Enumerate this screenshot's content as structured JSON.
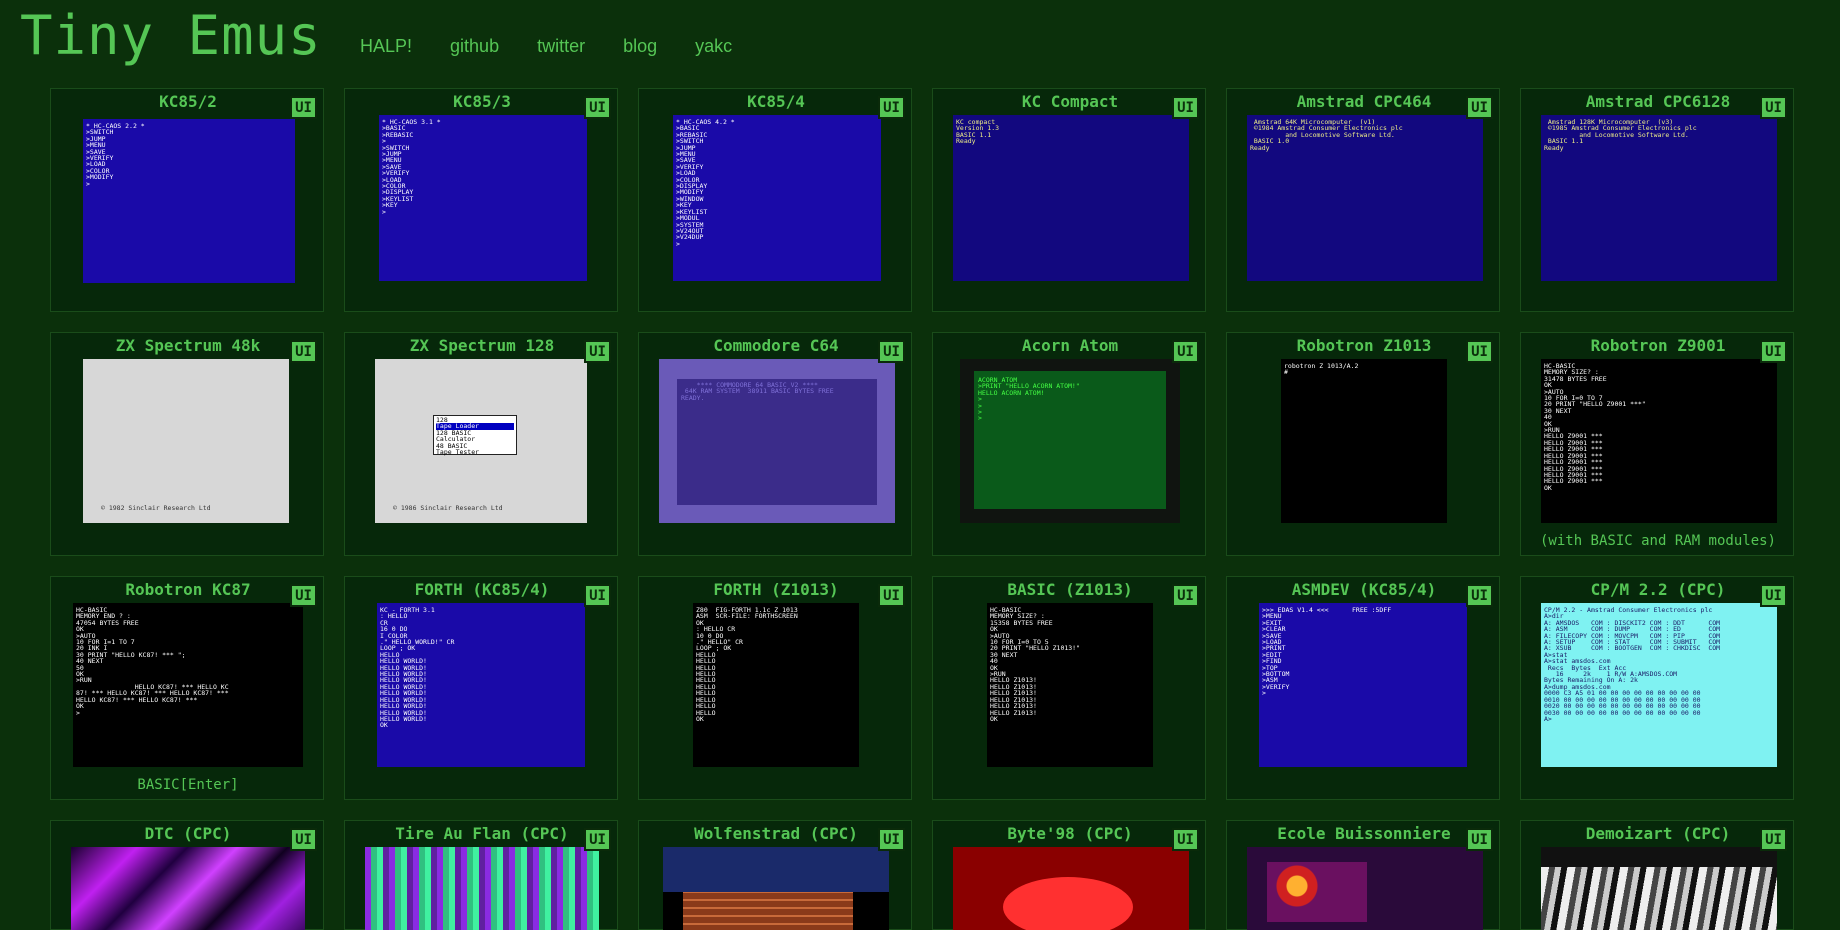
{
  "header": {
    "title": "Tiny Emus",
    "nav": [
      "HALP!",
      "github",
      "twitter",
      "blog",
      "yakc"
    ]
  },
  "ui_label": "UI",
  "cards": [
    {
      "title": "KC85/2",
      "caption": "",
      "screen": [
        "* HC-CAOS 2.2 *",
        ">SWITCH",
        ">JUMP",
        ">MENU",
        ">SAVE",
        ">VERIFY",
        ">LOAD",
        ">COLOR",
        ">MODIFY",
        ">"
      ]
    },
    {
      "title": "KC85/3",
      "caption": "",
      "screen": [
        "* HC-CAOS 3.1 *",
        ">BASIC",
        ">REBASIC",
        ">",
        ">SWITCH",
        ">JUMP",
        ">MENU",
        ">SAVE",
        ">VERIFY",
        ">LOAD",
        ">COLOR",
        ">DISPLAY",
        ">KEYLIST",
        ">KEY",
        ">"
      ]
    },
    {
      "title": "KC85/4",
      "caption": "",
      "screen": [
        "* HC-CAOS 4.2 *",
        ">BASIC",
        ">REBASIC",
        ">SWITCH",
        ">JUMP",
        ">MENU",
        ">SAVE",
        ">VERIFY",
        ">LOAD",
        ">COLOR",
        ">DISPLAY",
        ">MODIFY",
        ">WINDOW",
        ">KEY",
        ">KEYLIST",
        ">MODUL",
        ">SYSTEM",
        ">V24OUT",
        ">V24DUP",
        ">"
      ]
    },
    {
      "title": "KC Compact",
      "caption": "",
      "screen": [
        "KC compact",
        "Version 1.3",
        "",
        "BASIC 1.1",
        "",
        "Ready"
      ]
    },
    {
      "title": "Amstrad CPC464",
      "caption": "",
      "screen": [
        " Amstrad 64K Microcomputer  (v1)",
        "",
        " ©1984 Amstrad Consumer Electronics plc",
        "         and Locomotive Software Ltd.",
        "",
        " BASIC 1.0",
        "",
        "Ready"
      ]
    },
    {
      "title": "Amstrad CPC6128",
      "caption": "",
      "screen": [
        " Amstrad 128K Microcomputer  (v3)",
        "",
        " ©1985 Amstrad Consumer Electronics plc",
        "         and Locomotive Software Ltd.",
        "",
        " BASIC 1.1",
        "",
        "Ready"
      ]
    },
    {
      "title": "ZX Spectrum 48k",
      "caption": "",
      "screen": [
        "© 1982 Sinclair Research Ltd"
      ]
    },
    {
      "title": "ZX Spectrum 128",
      "caption": "",
      "screen": [
        "© 1986 Sinclair Research Ltd"
      ],
      "menu": [
        "128",
        "Tape Loader",
        "128 BASIC",
        "Calculator",
        "48 BASIC",
        "Tape Tester"
      ]
    },
    {
      "title": "Commodore C64",
      "caption": "",
      "screen": [
        "    **** COMMODORE 64 BASIC V2 ****",
        " 64K RAM SYSTEM  38911 BASIC BYTES FREE",
        "",
        "READY."
      ]
    },
    {
      "title": "Acorn Atom",
      "caption": "",
      "screen": [
        "ACORN ATOM",
        "",
        ">PRINT \"HELLO ACORN ATOM!\"",
        "HELLO ACORN ATOM!",
        ">",
        ">",
        ">",
        ">"
      ]
    },
    {
      "title": "Robotron Z1013",
      "caption": "",
      "screen": [
        "robotron Z 1013/A.2",
        "",
        "#"
      ]
    },
    {
      "title": "Robotron Z9001",
      "caption": "(with BASIC and RAM modules)",
      "screen": [
        "HC-BASIC",
        "MEMORY SIZE? :",
        "31478 BYTES FREE",
        "",
        "OK",
        ">AUTO",
        "10 FOR I=0 TO 7",
        "20 PRINT \"HELLO Z9001 ***\"",
        "30 NEXT",
        "40",
        "OK",
        ">RUN",
        "HELLO Z9001 ***",
        "HELLO Z9001 ***",
        "HELLO Z9001 ***",
        "HELLO Z9001 ***",
        "HELLO Z9001 ***",
        "HELLO Z9001 ***",
        "HELLO Z9001 ***",
        "HELLO Z9001 ***",
        "OK"
      ]
    },
    {
      "title": "Robotron KC87",
      "caption": "BASIC[Enter]",
      "screen": [
        "HC-BASIC",
        "",
        "MEMORY END ? :",
        "47054 BYTES FREE",
        "",
        "OK",
        ">AUTO",
        "10 FOR I=1 TO 7",
        "20 INK I",
        "30 PRINT \"HELLO KC87! *** \";",
        "40 NEXT",
        "50",
        "OK",
        ">RUN",
        "               HELLO KC87! *** HELLO KC",
        "87! *** HELLO KC87! *** HELLO KC87! ***",
        "HELLO KC87! *** HELLO KC87! ***",
        "OK",
        ">"
      ]
    },
    {
      "title": "FORTH (KC85/4)",
      "caption": "",
      "screen": [
        "KC - FORTH 3.1",
        ": HELLO",
        "CR",
        "16 0 DO",
        "I COLOR",
        ".\" HELLO WORLD!\" CR",
        "LOOP ; OK",
        "HELLO",
        "HELLO WORLD!",
        "HELLO WORLD!",
        "HELLO WORLD!",
        "HELLO WORLD!",
        "HELLO WORLD!",
        "HELLO WORLD!",
        "HELLO WORLD!",
        "HELLO WORLD!",
        "HELLO WORLD!",
        "HELLO WORLD!",
        "OK"
      ]
    },
    {
      "title": "FORTH (Z1013)",
      "caption": "",
      "screen": [
        "Z80  FIG-FORTH 1.1c Z 1013",
        "ASM  SCR-FILE: FORTHSCREEN",
        "",
        "OK",
        ": HELLO CR",
        "10 0 DO",
        ".\" HELLO\" CR",
        "LOOP ; OK",
        "HELLO",
        "HELLO",
        "HELLO",
        "HELLO",
        "HELLO",
        "HELLO",
        "HELLO",
        "HELLO",
        "HELLO",
        "HELLO",
        "OK"
      ]
    },
    {
      "title": "BASIC (Z1013)",
      "caption": "",
      "screen": [
        "HC-BASIC",
        "",
        "MEMORY SIZE? :",
        "15358 BYTES FREE",
        "",
        "OK",
        ">AUTO",
        "10 FOR I=0 TO 5",
        "20 PRINT \"HELLO Z1013!\"",
        "30 NEXT",
        "40",
        "OK",
        ">RUN",
        "HELLO Z1013!",
        "HELLO Z1013!",
        "HELLO Z1013!",
        "HELLO Z1013!",
        "HELLO Z1013!",
        "HELLO Z1013!",
        "OK"
      ]
    },
    {
      "title": "ASMDEV (KC85/4)",
      "caption": "",
      "screen": [
        ">>> EDAS V1.4 <<<      FREE :5DFF",
        "",
        ">MENU",
        ">EXIT",
        ">CLEAR",
        ">SAVE",
        ">LOAD",
        ">PRINT",
        ">EDIT",
        ">FIND",
        ">TOP",
        ">BOTTOM",
        ">ASM",
        ">VERIFY",
        ">"
      ]
    },
    {
      "title": "CP/M 2.2 (CPC)",
      "caption": "",
      "screen": [
        "CP/M 2.2 - Amstrad Consumer Electronics plc",
        "",
        "A>dir",
        "A: AMSDOS   COM : DISCKIT2 COM : DDT      COM",
        "A: ASM      COM : DUMP     COM : ED       COM",
        "A: FILECOPY COM : MOVCPM   COM : PIP      COM",
        "A: SETUP    COM : STAT     COM : SUBMIT   COM",
        "A: XSUB     COM : BOOTGEN  COM : CHKDISC  COM",
        "A>stat",
        "",
        "A>stat amsdos.com",
        "",
        " Recs  Bytes  Ext Acc",
        "   16     2k    1 R/W A:AMSDOS.COM",
        "Bytes Remaining On A: 2k",
        "",
        "A>dump amsdos.com",
        "",
        "0000 C3 A5 01 00 00 00 00 00 00 00 00 00",
        "0010 00 00 00 00 00 00 00 00 00 00 00 00",
        "0020 00 00 00 00 00 00 00 00 00 00 00 00",
        "0030 00 00 00 00 00 00 00 00 00 00 00 00",
        "",
        "A>"
      ]
    },
    {
      "title": "DTC (CPC)",
      "caption": "",
      "screen": []
    },
    {
      "title": "Tire Au Flan (CPC)",
      "caption": "",
      "screen": []
    },
    {
      "title": "Wolfenstrad (CPC)",
      "caption": "",
      "screen": []
    },
    {
      "title": "Byte'98 (CPC)",
      "caption": "",
      "screen": []
    },
    {
      "title": "Ecole Buissonniere",
      "caption": "",
      "screen": []
    },
    {
      "title": "Demoizart (CPC)",
      "caption": "",
      "screen": []
    }
  ]
}
